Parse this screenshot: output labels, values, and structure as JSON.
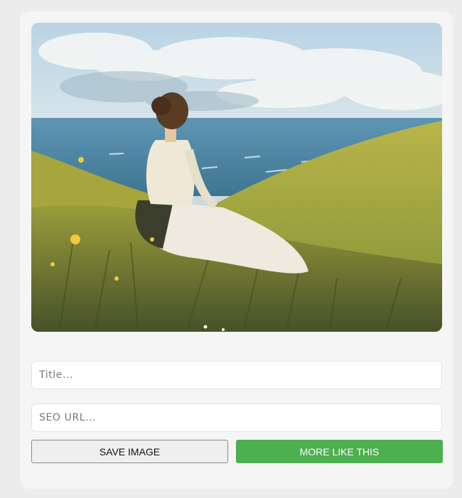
{
  "image": {
    "alt_name": "painting-woman-on-grassy-hill-by-sea",
    "colors": {
      "sky": "#a9c7dc",
      "sea": "#4f86a3",
      "grass": "#a6ab37",
      "accent": "#4caf50"
    }
  },
  "form": {
    "title_placeholder": "Title...",
    "seo_placeholder": "SEO URL..."
  },
  "actions": {
    "save_label": "SAVE IMAGE",
    "more_label": "MORE LIKE THIS"
  }
}
